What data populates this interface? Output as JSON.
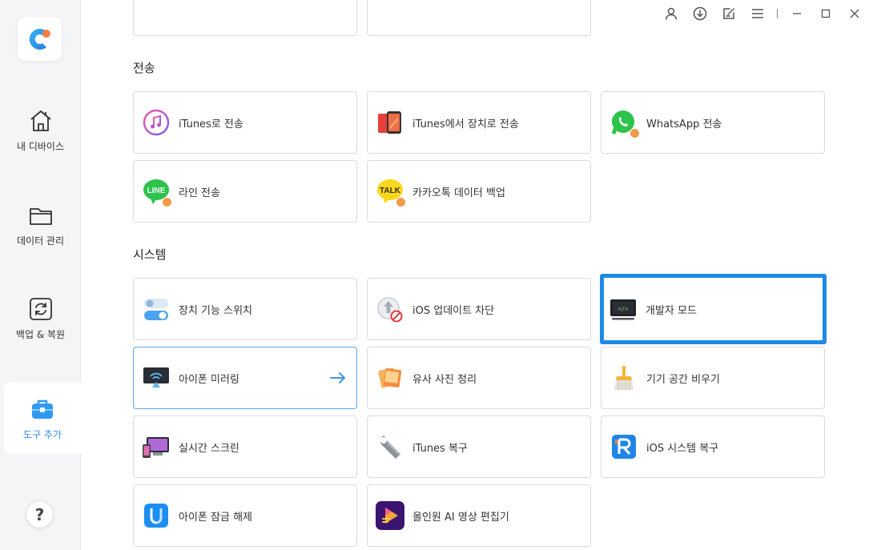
{
  "sidebar": {
    "items": [
      {
        "label": "내 디바이스",
        "icon": "home-icon"
      },
      {
        "label": "데이터 관리",
        "icon": "folder-icon"
      },
      {
        "label": "백업 & 복원",
        "icon": "backup-restore-icon"
      },
      {
        "label": "도구 추가",
        "icon": "toolbox-icon",
        "active": true
      }
    ],
    "help": "?"
  },
  "sections": {
    "transfer": {
      "title": "전송",
      "cards": [
        {
          "label": "iTunes로 전송"
        },
        {
          "label": "iTunes에서 장치로 전송"
        },
        {
          "label": "WhatsApp 전송"
        },
        {
          "label": "라인 전송"
        },
        {
          "label": "카카오톡 데이터 백업"
        }
      ]
    },
    "system": {
      "title": "시스템",
      "cards": [
        {
          "label": "장치 기능 스위치"
        },
        {
          "label": "iOS 업데이트 차단"
        },
        {
          "label": "개발자 모드"
        },
        {
          "label": "아이폰 미러링"
        },
        {
          "label": "유사 사진 정리"
        },
        {
          "label": "기기 공간 비우기"
        },
        {
          "label": "실시간 스크린"
        },
        {
          "label": "iTunes 복구"
        },
        {
          "label": "iOS 시스템 복구"
        },
        {
          "label": "아이폰 잠금 해제"
        },
        {
          "label": "올인원 AI 영상 편집기"
        }
      ]
    }
  },
  "icons": {
    "line_logo_text": "LINE",
    "talk_logo_text": "TALK"
  },
  "colors": {
    "accent": "#1e8ae6",
    "sidebar_bg": "#f4f5f7"
  }
}
